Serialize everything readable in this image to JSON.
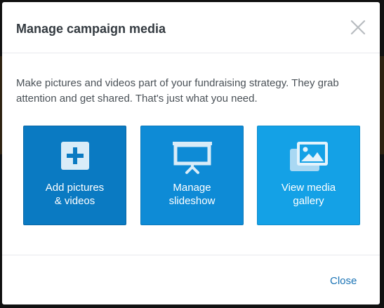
{
  "dialog": {
    "title": "Manage campaign media",
    "close_icon": "close-icon",
    "intro": "Make pictures and videos part of your fundraising strategy. They grab attention and get shared. That's just what you need."
  },
  "tiles": [
    {
      "label": "Add pictures\n& videos",
      "icon": "plus-square-icon",
      "color": "#0a7ac2"
    },
    {
      "label": "Manage\nslideshow",
      "icon": "presentation-screen-icon",
      "color": "#0e8bd6"
    },
    {
      "label": "View media\ngallery",
      "icon": "image-gallery-icon",
      "color": "#14a1e6"
    }
  ],
  "footer": {
    "close_label": "Close"
  },
  "colors": {
    "title_text": "#333a40",
    "body_text": "#4a5157",
    "link": "#1a73b5"
  }
}
